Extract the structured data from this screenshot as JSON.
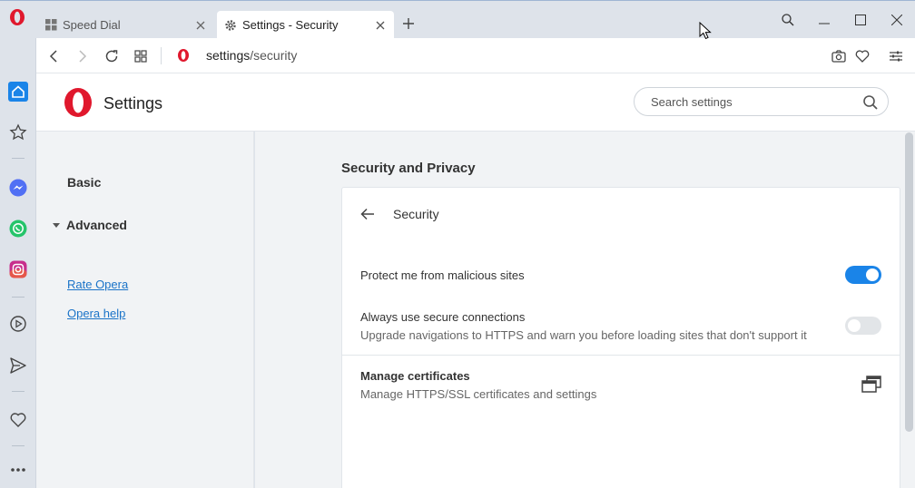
{
  "browser": {
    "accent": "#1a84e8",
    "tabs": [
      {
        "title": "Speed Dial",
        "icon": "speed-dial-icon",
        "active": false
      },
      {
        "title": "Settings - Security",
        "icon": "gear-icon",
        "active": true
      }
    ],
    "address": {
      "host": "settings",
      "path": "/security"
    }
  },
  "sidebar": {
    "items": [
      {
        "name": "home-icon"
      },
      {
        "name": "bookmarks-icon"
      },
      {
        "name": "messenger-icon"
      },
      {
        "name": "whatsapp-icon"
      },
      {
        "name": "instagram-icon"
      },
      {
        "name": "player-icon"
      },
      {
        "name": "send-icon"
      },
      {
        "name": "heart-icon"
      },
      {
        "name": "more-icon"
      }
    ]
  },
  "settings": {
    "title": "Settings",
    "search_placeholder": "Search settings",
    "nav": {
      "basic": "Basic",
      "advanced": "Advanced",
      "links": [
        "Rate Opera",
        "Opera help"
      ]
    },
    "section_title": "Security and Privacy",
    "card": {
      "heading": "Security",
      "rows": [
        {
          "label": "Protect me from malicious sites",
          "toggle": true
        },
        {
          "label": "Always use secure connections",
          "sub": "Upgrade navigations to HTTPS and warn you before loading sites that don't support it",
          "toggle": false
        },
        {
          "label": "Manage certificates",
          "sub": "Manage HTTPS/SSL certificates and settings"
        }
      ]
    }
  }
}
